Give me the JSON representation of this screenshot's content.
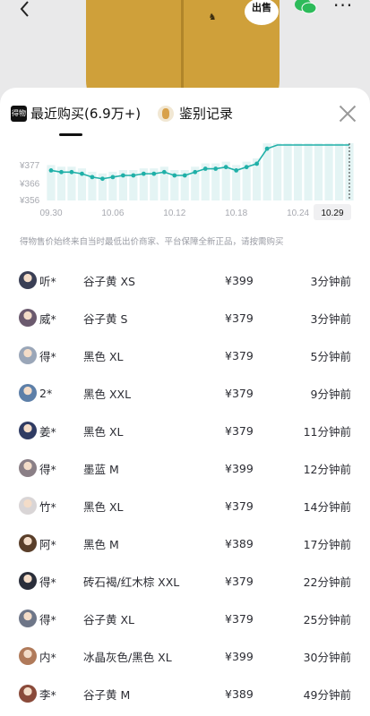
{
  "header": {
    "back_icon": "chevron-left-icon",
    "sell_label": "出售",
    "wechat_icon": "wechat-icon",
    "more_icon": "more-dots-icon"
  },
  "tabs": [
    {
      "badge": "得物",
      "label": "最近购买(6.9万+)",
      "active": true
    },
    {
      "label": "鉴别记录",
      "active": false
    }
  ],
  "chart_data": {
    "type": "line",
    "x": [
      "09.30",
      "10.01",
      "10.02",
      "10.03",
      "10.04",
      "10.05",
      "10.06",
      "10.07",
      "10.08",
      "10.09",
      "10.10",
      "10.11",
      "10.12",
      "10.13",
      "10.14",
      "10.15",
      "10.16",
      "10.17",
      "10.18",
      "10.19",
      "10.20",
      "10.21",
      "10.22",
      "10.23",
      "10.24",
      "10.25",
      "10.26",
      "10.27",
      "10.28",
      "10.29"
    ],
    "values": [
      374,
      373,
      373,
      372,
      370,
      369,
      370,
      371,
      371,
      372,
      372,
      373,
      371,
      371,
      373,
      375,
      375,
      376,
      374,
      376,
      378,
      387,
      392,
      395,
      395,
      396,
      396,
      396,
      396,
      396
    ],
    "tick_labels_x": [
      "09.30",
      "10.06",
      "10.12",
      "10.18",
      "10.24",
      "10.29"
    ],
    "tick_labels_y": [
      "¥377",
      "¥366",
      "¥356"
    ],
    "y_ticks": [
      377,
      366,
      356
    ],
    "ylim": [
      356,
      386
    ],
    "highlight_x": "10.29",
    "line_color": "#20b0a8",
    "bar_color": "#e4f4f4"
  },
  "disclaimer": "得物售价始终来自当时最低出价商家、平台保障全新正品，请按需购买",
  "purchases": [
    {
      "user": "听*",
      "item": "谷子黄 XS",
      "price": "¥399",
      "time": "3分钟前"
    },
    {
      "user": "威*",
      "item": "谷子黄 S",
      "price": "¥379",
      "time": "3分钟前"
    },
    {
      "user": "得*",
      "item": "黑色 XL",
      "price": "¥379",
      "time": "5分钟前"
    },
    {
      "user": "2*",
      "item": "黑色 XXL",
      "price": "¥379",
      "time": "9分钟前"
    },
    {
      "user": "姜*",
      "item": "黑色 XL",
      "price": "¥379",
      "time": "11分钟前"
    },
    {
      "user": "得*",
      "item": "墨蓝 M",
      "price": "¥399",
      "time": "12分钟前"
    },
    {
      "user": "竹*",
      "item": "黑色 XL",
      "price": "¥379",
      "time": "14分钟前"
    },
    {
      "user": "阿*",
      "item": "黑色 M",
      "price": "¥389",
      "time": "17分钟前"
    },
    {
      "user": "得*",
      "item": "砖石褐/红木棕 XXL",
      "price": "¥379",
      "time": "22分钟前"
    },
    {
      "user": "得*",
      "item": "谷子黄 XL",
      "price": "¥379",
      "time": "25分钟前"
    },
    {
      "user": "内*",
      "item": "冰晶灰色/黑色 XL",
      "price": "¥399",
      "time": "30分钟前"
    },
    {
      "user": "李*",
      "item": "谷子黄 M",
      "price": "¥389",
      "time": "49分钟前"
    }
  ],
  "avatar_colors": [
    "#3a3f55",
    "#6b5a6e",
    "#9aa6b8",
    "#5d7fa8",
    "#2f3b63",
    "#8a7f86",
    "#d9d5d6",
    "#5a3f2a",
    "#2a2e3a",
    "#6e7688",
    "#b07a5a",
    "#8a4a3a"
  ]
}
